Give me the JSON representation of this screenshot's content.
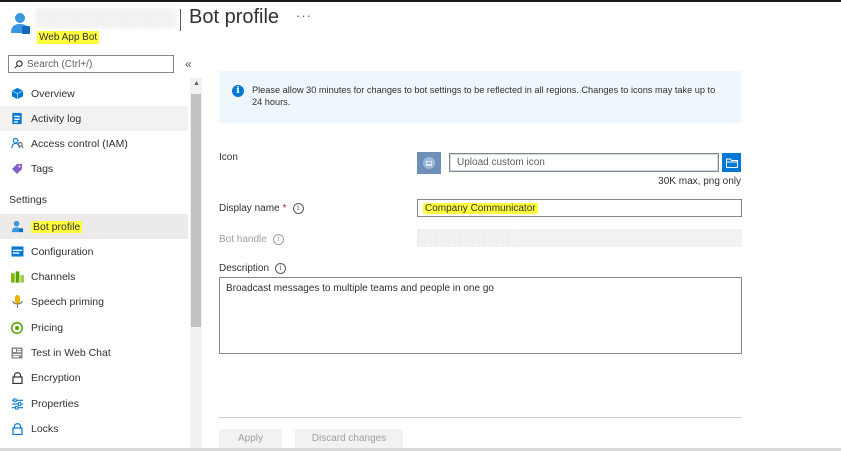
{
  "header": {
    "resource_type": "Web App Bot",
    "page_title": "Bot profile",
    "more_label": "···"
  },
  "sidebar": {
    "search_placeholder": "Search (Ctrl+/)",
    "collapse_label": "«",
    "section_settings": "Settings",
    "items": [
      {
        "label": "Overview",
        "icon": "overview-icon"
      },
      {
        "label": "Activity log",
        "icon": "activity-log-icon"
      },
      {
        "label": "Access control (IAM)",
        "icon": "access-control-icon"
      },
      {
        "label": "Tags",
        "icon": "tag-icon"
      },
      {
        "label": "Bot profile",
        "icon": "bot-profile-icon",
        "selected": true
      },
      {
        "label": "Configuration",
        "icon": "configuration-icon"
      },
      {
        "label": "Channels",
        "icon": "channels-icon"
      },
      {
        "label": "Speech priming",
        "icon": "speech-priming-icon"
      },
      {
        "label": "Pricing",
        "icon": "pricing-icon"
      },
      {
        "label": "Test in Web Chat",
        "icon": "web-chat-icon"
      },
      {
        "label": "Encryption",
        "icon": "lock-icon"
      },
      {
        "label": "Properties",
        "icon": "properties-icon"
      },
      {
        "label": "Locks",
        "icon": "lock-icon"
      }
    ]
  },
  "info_bar": {
    "message": "Please allow 30 minutes for changes to bot settings to be reflected in all regions. Changes to icons may take up to 24 hours."
  },
  "form": {
    "icon_label": "Icon",
    "upload_placeholder": "Upload custom icon",
    "upload_hint": "30K max, png only",
    "display_name_label": "Display name",
    "required_mark": "*",
    "display_name_value": "Company Communicator",
    "bot_handle_label": "Bot handle",
    "description_label": "Description",
    "description_value": "Broadcast messages to multiple teams and people in one go",
    "info_glyph": "i"
  },
  "actions": {
    "apply_label": "Apply",
    "discard_label": "Discard changes"
  },
  "colors": {
    "accent": "#0078d4",
    "highlight": "#ffff3c",
    "info_background": "#eff6fc"
  }
}
